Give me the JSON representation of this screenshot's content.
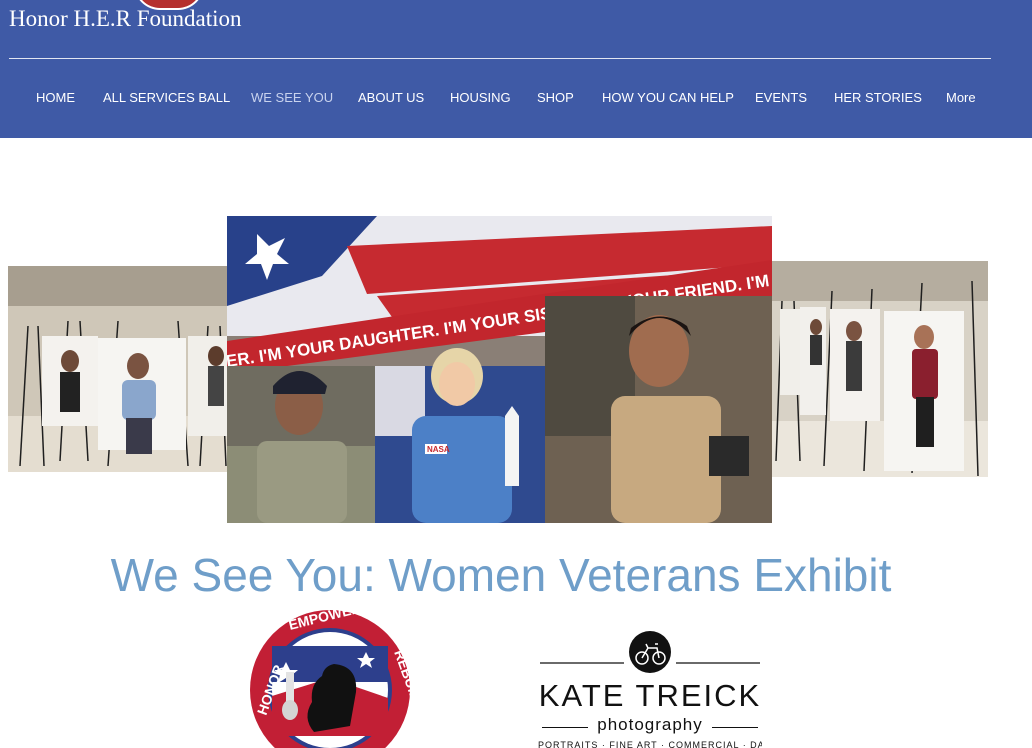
{
  "site": {
    "title": "Honor H.E.R Foundation"
  },
  "nav": {
    "items": [
      {
        "label": "HOME"
      },
      {
        "label": "ALL SERVICES BALL"
      },
      {
        "label": "WE SEE YOU"
      },
      {
        "label": "ABOUT US"
      },
      {
        "label": "HOUSING"
      },
      {
        "label": "SHOP"
      },
      {
        "label": "HOW YOU CAN HELP"
      },
      {
        "label": "EVENTS"
      },
      {
        "label": "HER STORIES"
      },
      {
        "label": "More"
      }
    ],
    "active": "WE SEE YOU"
  },
  "banner": {
    "tagline": "ER. I'M YOUR DAUGHTER. I'M YOUR SISTER. I'M YOUR FRIEND. I'M Y",
    "badge": "NASA"
  },
  "page": {
    "heading": "We See You: Women Veterans Exhibit"
  },
  "sponsors": {
    "empower": {
      "ring_text_left": "HONOR",
      "ring_text_top": "EMPOWER",
      "ring_text_right": "REBUILD"
    },
    "kate": {
      "name": "KATE TREICK",
      "sub": "photography",
      "tagline": "PORTRAITS · FINE ART · COMMERCIAL · DANCE"
    }
  },
  "colors": {
    "header_bg": "#3f5aa6",
    "heading": "#6f9ec9",
    "nav_text": "#ffffff",
    "nav_active": "#c9d3ee"
  }
}
